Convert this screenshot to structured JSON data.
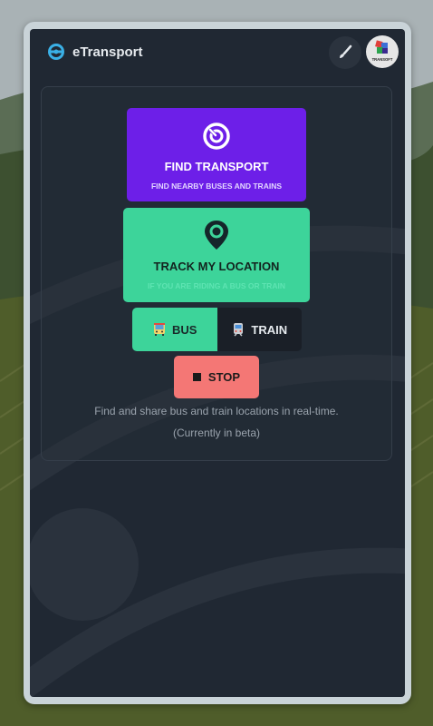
{
  "app": {
    "title": "eTransport",
    "logo_icon": "steering-wheel-icon",
    "theme_icon": "paintbrush-icon",
    "avatar_label": "TRANSOFT"
  },
  "find_transport": {
    "label": "FIND TRANSPORT",
    "subtitle": "FIND NEARBY BUSES AND TRAINS",
    "icon": "target-icon"
  },
  "track_location": {
    "label": "TRACK MY LOCATION",
    "subtitle": "IF YOU ARE RIDING A BUS OR TRAIN",
    "icon": "map-pin-icon"
  },
  "mode_toggle": {
    "options": [
      {
        "label": "BUS",
        "icon": "bus-icon",
        "selected": true
      },
      {
        "label": "TRAIN",
        "icon": "train-icon",
        "selected": false
      }
    ]
  },
  "stop": {
    "label": "STOP",
    "icon": "stop-icon"
  },
  "description": {
    "line1": "Find and share bus and train locations in real-time.",
    "line2": "(Currently in beta)"
  },
  "colors": {
    "accent_purple": "#6d1fe8",
    "accent_green": "#3dd49a",
    "stop_red": "#f47775",
    "panel": "#202833"
  }
}
